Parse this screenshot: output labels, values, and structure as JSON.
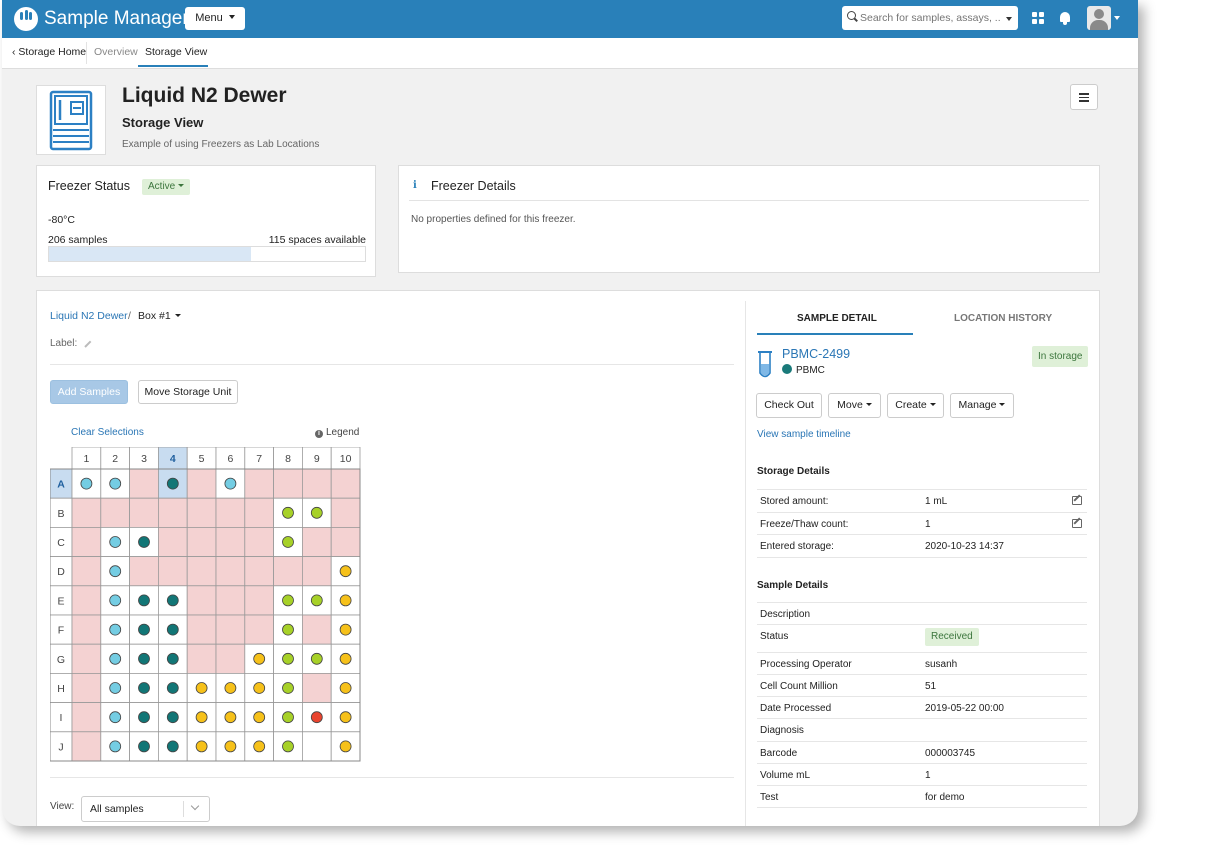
{
  "app": {
    "brand": "Sample Manager",
    "menu_label": "Menu",
    "search_placeholder": "Search for samples, assays, ..."
  },
  "subnav": {
    "back": "Storage Home",
    "tabs": [
      "Overview",
      "Storage View"
    ],
    "active_tab": "Storage View"
  },
  "header": {
    "title": "Liquid N2 Dewer",
    "subtitle": "Storage View",
    "description": "Example of using Freezers as Lab Locations"
  },
  "freezer_status": {
    "title": "Freezer Status",
    "status": "Active",
    "temperature": "-80°C",
    "samples": "206 samples",
    "spaces": "115 spaces available",
    "fill_fraction": 0.64
  },
  "freezer_details": {
    "title": "Freezer Details",
    "text": "No properties defined for this freezer."
  },
  "box": {
    "breadcrumb_link": "Liquid N2 Dewer",
    "breadcrumb_sep": "/",
    "current": "Box #1",
    "label": "Label:",
    "add_samples": "Add Samples",
    "move_storage": "Move Storage Unit",
    "clear_selections": "Clear Selections",
    "legend": "Legend",
    "columns": [
      "1",
      "2",
      "3",
      "4",
      "5",
      "6",
      "7",
      "8",
      "9",
      "10"
    ],
    "rows": [
      "A",
      "B",
      "C",
      "D",
      "E",
      "F",
      "G",
      "H",
      "I",
      "J"
    ],
    "selected_row": 0,
    "selected_col": 3,
    "cells": [
      "LLPTPLPPPP",
      "PPPPPPPGGP",
      "PLTPPPPGPP",
      "PLPPPPPPPY",
      "PLTTPPPGGY",
      "PLTTPPPGPY",
      "PLTTPPYGGY",
      "PLTTYYYGPY",
      "PLTTYYYGRY",
      "PLTTYYYGEY"
    ],
    "colors": {
      "light_blue": "#74cde3",
      "teal": "#127676",
      "green": "#a7d128",
      "yellow": "#f6c11a",
      "red": "#e9442f",
      "occupied": "#f4d2d2",
      "selected": "#c8dcf0"
    },
    "view_label": "View:",
    "view_value": "All samples"
  },
  "detail": {
    "tabs": [
      "SAMPLE DETAIL",
      "LOCATION HISTORY"
    ],
    "sample_name": "PBMC-2499",
    "sample_type": "PBMC",
    "storage_status": "In storage",
    "actions": [
      "Check Out",
      "Move",
      "Create",
      "Manage"
    ],
    "timeline_link": "View sample timeline",
    "storage_details_title": "Storage Details",
    "storage_details": [
      {
        "label": "Stored amount:",
        "value": "1 mL"
      },
      {
        "label": "Freeze/Thaw count:",
        "value": "1"
      },
      {
        "label": "Entered storage:",
        "value": "2020-10-23 14:37"
      }
    ],
    "sample_details_title": "Sample Details",
    "sample_details": [
      {
        "label": "Description",
        "value": ""
      },
      {
        "label": "Status",
        "value": "Received"
      },
      {
        "label": "Processing Operator",
        "value": "susanh"
      },
      {
        "label": "Cell Count Million",
        "value": "51"
      },
      {
        "label": "Date Processed",
        "value": "2019-05-22 00:00"
      },
      {
        "label": "Diagnosis",
        "value": ""
      },
      {
        "label": "Barcode",
        "value": "000003745"
      },
      {
        "label": "Volume mL",
        "value": "1"
      },
      {
        "label": "Test",
        "value": "for demo"
      }
    ]
  }
}
